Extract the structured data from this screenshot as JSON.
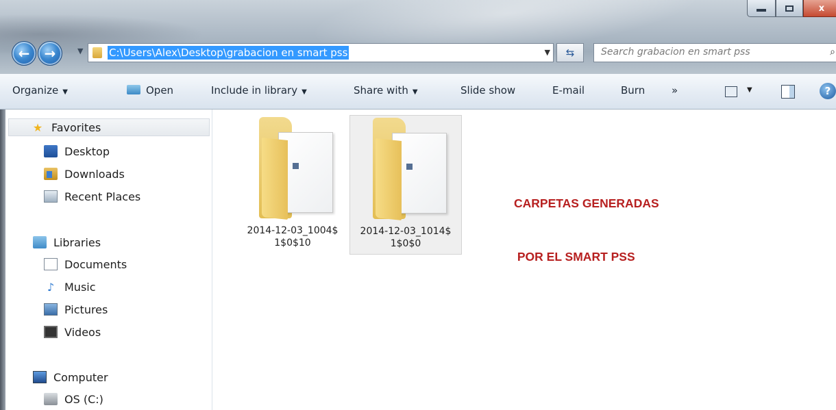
{
  "window": {
    "close_label": "x"
  },
  "address_bar": {
    "path": "C:\\Users\\Alex\\Desktop\\grabacion en smart pss"
  },
  "search": {
    "placeholder": "Search grabacion en smart pss"
  },
  "toolbar": {
    "organize": "Organize",
    "open": "Open",
    "include_in_library": "Include in library",
    "share_with": "Share with",
    "slide_show": "Slide show",
    "email": "E-mail",
    "burn": "Burn",
    "more": "»",
    "help": "?"
  },
  "sidebar": {
    "favorites": "Favorites",
    "desktop": "Desktop",
    "downloads": "Downloads",
    "recent_places": "Recent Places",
    "libraries": "Libraries",
    "documents": "Documents",
    "music": "Music",
    "pictures": "Pictures",
    "videos": "Videos",
    "computer": "Computer",
    "os_drive": "OS (C:)"
  },
  "files": [
    {
      "line1": "2014-12-03_1004$",
      "line2": "1$0$10"
    },
    {
      "line1": "2014-12-03_1014$",
      "line2": "1$0$0"
    }
  ],
  "annotation": {
    "line1": "CARPETAS GENERADAS",
    "line2": " POR EL SMART PSS"
  },
  "colors": {
    "annotation": "#b72020",
    "selection": "#3399ff"
  }
}
